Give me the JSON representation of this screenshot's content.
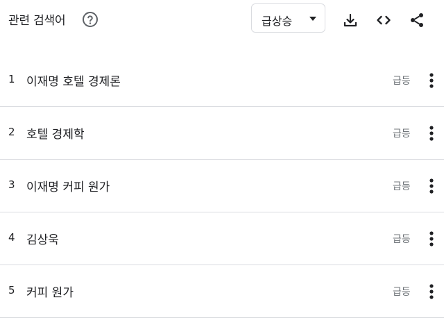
{
  "header": {
    "title": "관련 검색어",
    "help_icon": "help-circle-icon",
    "sort_dropdown": {
      "selected": "급상승",
      "icon": "caret-down-icon"
    },
    "tools": [
      "download-icon",
      "embed-code-icon",
      "share-icon"
    ]
  },
  "related_queries": [
    {
      "rank": "1",
      "query": "이재명 호텔 경제론",
      "status": "급등"
    },
    {
      "rank": "2",
      "query": "호텔 경제학",
      "status": "급등"
    },
    {
      "rank": "3",
      "query": "이재명 커피 원가",
      "status": "급등"
    },
    {
      "rank": "4",
      "query": "김상욱",
      "status": "급등"
    },
    {
      "rank": "5",
      "query": "커피 원가",
      "status": "급등"
    }
  ],
  "colors": {
    "text": "#202124",
    "secondary_text": "#70757a",
    "divider": "#dadce0",
    "icon": "#202124"
  }
}
